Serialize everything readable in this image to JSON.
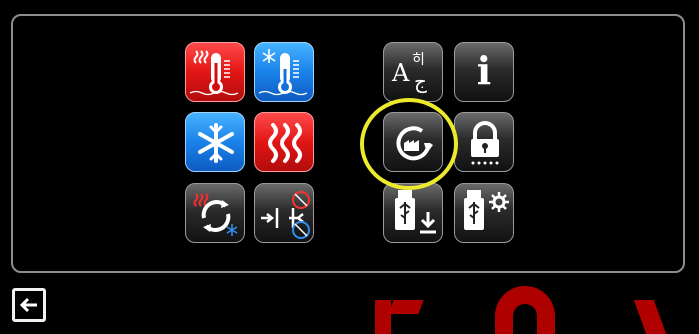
{
  "tiles": [
    {
      "name": "heating-temperature-icon",
      "color": "red"
    },
    {
      "name": "cooling-temperature-icon",
      "color": "blue"
    },
    {
      "name": "cooling-mode-icon",
      "color": "blue"
    },
    {
      "name": "heating-mode-icon",
      "color": "red"
    },
    {
      "name": "auto-mode-icon",
      "color": "dark"
    },
    {
      "name": "dead-band-icon",
      "color": "dark"
    },
    {
      "name": "language-icon",
      "color": "dark"
    },
    {
      "name": "info-icon",
      "color": "dark"
    },
    {
      "name": "factory-reset-icon",
      "color": "dark"
    },
    {
      "name": "password-lock-icon",
      "color": "dark"
    },
    {
      "name": "usb-download-icon",
      "color": "dark"
    },
    {
      "name": "usb-settings-icon",
      "color": "dark"
    }
  ],
  "highlight": {
    "target": "factory-reset-icon",
    "color": "#ecea2a"
  },
  "language_glyph_top": "히",
  "language_glyph_bottom": "ج",
  "language_glyph_latin": "A",
  "info_glyph": "i"
}
